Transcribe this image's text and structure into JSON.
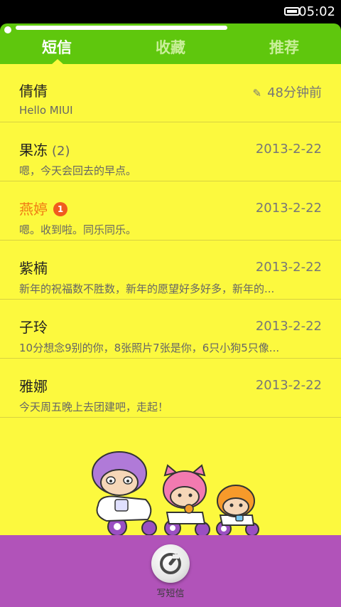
{
  "status": {
    "time": "05:02"
  },
  "tabs": [
    {
      "label": "短信"
    },
    {
      "label": "收藏"
    },
    {
      "label": "推荐"
    }
  ],
  "conversations": [
    {
      "name": "倩倩",
      "count": "",
      "badge": "",
      "date": "48分钟前",
      "preview": "Hello MIUI",
      "unread": false,
      "draft": true
    },
    {
      "name": "果冻",
      "count": "(2)",
      "badge": "",
      "date": "2013-2-22",
      "preview": "嗯，今天会回去的早点。",
      "unread": false,
      "draft": false
    },
    {
      "name": "燕婷",
      "count": "",
      "badge": "1",
      "date": "2013-2-22",
      "preview": "嗯。收到啦。同乐同乐。",
      "unread": true,
      "draft": false
    },
    {
      "name": "紫楠",
      "count": "",
      "badge": "",
      "date": "2013-2-22",
      "preview": "新年的祝福数不胜数，新年的愿望好多好多，新年的...",
      "unread": false,
      "draft": false
    },
    {
      "name": "子玲",
      "count": "",
      "badge": "",
      "date": "2013-2-22",
      "preview": "10分想念9别的你，8张照片7张是你，6只小狗5只像...",
      "unread": false,
      "draft": false
    },
    {
      "name": "雅娜",
      "count": "",
      "badge": "",
      "date": "2013-2-22",
      "preview": "今天周五晚上去团建吧，走起！",
      "unread": false,
      "draft": false
    }
  ],
  "compose": {
    "label": "写短信"
  },
  "colors": {
    "header": "#5fc70d",
    "list_bg": "#fcf93e",
    "bottom_bar": "#b153b9",
    "unread_name": "#f07a14",
    "badge": "#f05b1e"
  }
}
